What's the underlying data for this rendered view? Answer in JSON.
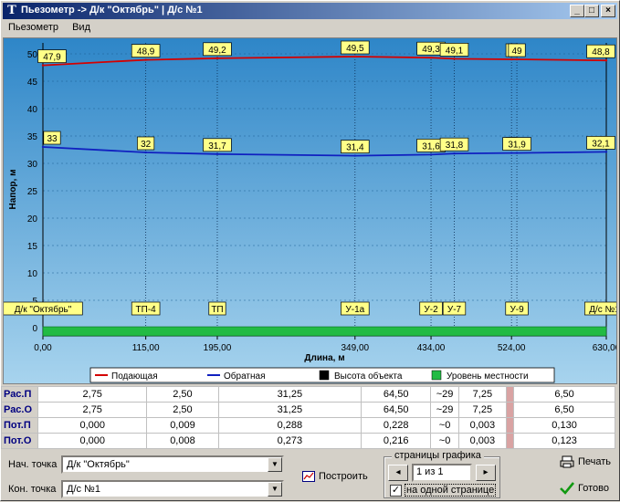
{
  "window": {
    "title": "Пьезометр -> Д/к \"Октябрь\" | Д/с №1",
    "buttons": {
      "minimize": "_",
      "maximize": "□",
      "close": "×"
    }
  },
  "menu": [
    {
      "label": "Пьезометр"
    },
    {
      "label": "Вид"
    }
  ],
  "chart_data": {
    "type": "line",
    "ylabel": "Напор, м",
    "xlabel": "Длина, м",
    "ylim": [
      -1.5,
      52
    ],
    "xlim": [
      0,
      630
    ],
    "y_ticks": [
      0,
      5,
      10,
      15,
      20,
      25,
      30,
      35,
      40,
      45,
      50
    ],
    "x_ticks": [
      "0,00",
      "115,00",
      "195,00",
      "349,00",
      "434,00",
      "524,00",
      "630,00"
    ],
    "x_tick_values": [
      0,
      115,
      195,
      349,
      434,
      524,
      630
    ],
    "points_x": [
      0,
      115,
      195,
      349,
      434,
      460,
      524,
      530,
      630
    ],
    "series": [
      {
        "name": "Подающая",
        "color": "#d40000",
        "values": [
          47.9,
          48.9,
          49.2,
          49.5,
          49.3,
          49.1,
          49.0,
          49.0,
          48.8
        ],
        "labels": [
          "47,9",
          "48,9",
          "49,2",
          "49,5",
          "49,3",
          "49,1",
          "4",
          "49",
          "48,8"
        ]
      },
      {
        "name": "Обратная",
        "color": "#1020c0",
        "values": [
          33.0,
          32.0,
          31.7,
          31.4,
          31.6,
          31.8,
          31.9,
          31.9,
          32.1
        ],
        "labels": [
          "33",
          "32",
          "31,7",
          "31,4",
          "31,6",
          "31,8",
          "3",
          "31,9",
          "32,1"
        ]
      }
    ],
    "nodes": [
      "Д/к \"Октябрь\"",
      "ТП-4",
      "ТП",
      "У-1а",
      "У-2",
      "У-7",
      "У",
      "У-9",
      "Д/с №1"
    ],
    "legend": [
      {
        "name": "Подающая",
        "color": "#d40000",
        "kind": "line"
      },
      {
        "name": "Обратная",
        "color": "#1020c0",
        "kind": "line"
      },
      {
        "name": "Высота объекта",
        "color": "#000000",
        "kind": "box"
      },
      {
        "name": "Уровень местности",
        "color": "#22bb44",
        "kind": "box"
      }
    ]
  },
  "table": {
    "rows": [
      {
        "head": "Рас.П",
        "cells": [
          "2,75",
          "2,50",
          "31,25",
          "64,50",
          "~29",
          "7,25",
          "",
          "6,50"
        ]
      },
      {
        "head": "Рас.О",
        "cells": [
          "2,75",
          "2,50",
          "31,25",
          "64,50",
          "~29",
          "7,25",
          "",
          "6,50"
        ]
      },
      {
        "head": "Пот.П",
        "cells": [
          "0,000",
          "0,009",
          "0,288",
          "0,228",
          "~0",
          "0,003",
          "",
          "0,130"
        ]
      },
      {
        "head": "Пот.О",
        "cells": [
          "0,000",
          "0,008",
          "0,273",
          "0,216",
          "~0",
          "0,003",
          "",
          "0,123"
        ]
      }
    ]
  },
  "controls": {
    "start_label": "Нач. точка",
    "start_value": "Д/к \"Октябрь\"",
    "end_label": "Кон. точка",
    "end_value": "Д/с №1",
    "build_label": "Построить",
    "pages_title": "страницы графика",
    "page_value": "1 из 1",
    "one_page_label": "на одной странице",
    "print_label": "Печать",
    "done_label": "Готово"
  }
}
